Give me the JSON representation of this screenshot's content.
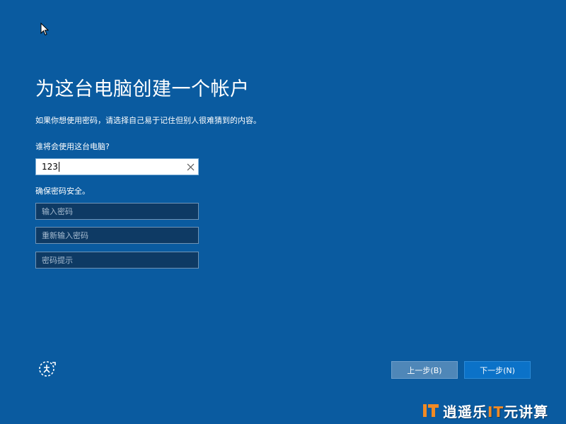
{
  "page": {
    "title": "为这台电脑创建一个帐户",
    "subtitle": "如果你想使用密码，请选择自己易于记住但别人很难猜到的内容。"
  },
  "user_section": {
    "label": "谁将会使用这台电脑?",
    "username_value": "123"
  },
  "security_section": {
    "label": "确保密码安全。",
    "password_placeholder": "输入密码",
    "confirm_placeholder": "重新输入密码",
    "hint_placeholder": "密码提示"
  },
  "buttons": {
    "back_label": "上一步(B)",
    "next_label": "下一步(N)"
  },
  "watermark": {
    "text_main": "逍遥乐",
    "text_accent": "IT",
    "text_tail": "元讲算"
  },
  "icons": {
    "cursor": "mouse-pointer-icon",
    "clear": "clear-x-icon",
    "ease_of_access": "ease-of-access-icon",
    "watermark_logo": "watermark-logo-icon"
  },
  "colors": {
    "background": "#0a5ba0",
    "next_button": "#0b72c8",
    "back_button": "#4f87b8",
    "accent": "#f08a24"
  }
}
